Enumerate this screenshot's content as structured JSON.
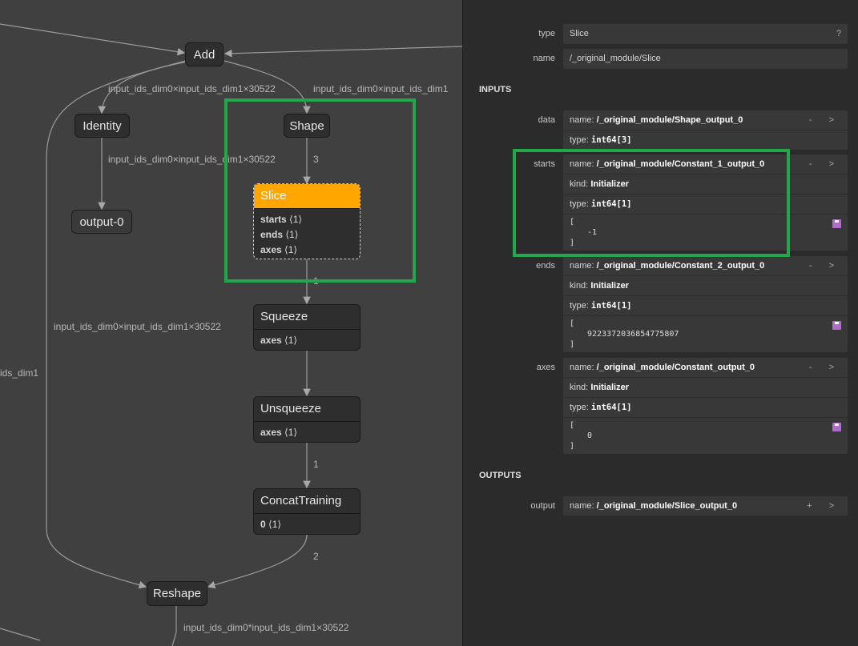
{
  "graph": {
    "nodes": {
      "add": "Add",
      "identity": "Identity",
      "shape": "Shape",
      "output0": "output-0",
      "slice": "Slice",
      "squeeze": "Squeeze",
      "unsqueeze": "Unsqueeze",
      "concat": "ConcatTraining",
      "reshape": "Reshape"
    },
    "slice_attrs": [
      {
        "k": "starts",
        "v": "⟨1⟩"
      },
      {
        "k": "ends",
        "v": "⟨1⟩"
      },
      {
        "k": "axes",
        "v": "⟨1⟩"
      }
    ],
    "squeeze_attrs": [
      {
        "k": "axes",
        "v": "⟨1⟩"
      }
    ],
    "unsqueeze_attrs": [
      {
        "k": "axes",
        "v": "⟨1⟩"
      }
    ],
    "concat_attrs": [
      {
        "k": "0",
        "v": "⟨1⟩"
      }
    ],
    "edge_labels": {
      "add_left": "input_ids_dim0×input_ids_dim1×30522",
      "add_right": "input_ids_dim0×input_ids_dim1",
      "identity_out": "input_ids_dim0×input_ids_dim1×30522",
      "shape_out": "3",
      "slice_out": "1",
      "bypass": "input_ids_dim0×input_ids_dim1×30522",
      "left_edge": "ids_dim1",
      "unsqueeze_out": "1",
      "concat_out": "2",
      "reshape_out": "input_ids_dim0*input_ids_dim1×30522"
    }
  },
  "panel": {
    "type_label": "type",
    "type_value": "Slice",
    "type_help": "?",
    "name_label": "name",
    "name_value": "/_original_module/Slice",
    "inputs_heading": "INPUTS",
    "outputs_heading": "OUTPUTS",
    "inputs": {
      "data": {
        "label": "data",
        "name_key": "name:",
        "name": "/_original_module/Shape_output_0",
        "type_key": "type:",
        "type": "int64[3]",
        "ctrl": "- >"
      },
      "starts": {
        "label": "starts",
        "name_key": "name:",
        "name": "/_original_module/Constant_1_output_0",
        "kind_key": "kind:",
        "kind": "Initializer",
        "type_key": "type:",
        "type": "int64[1]",
        "open": "[",
        "value": "-1",
        "close": "]",
        "ctrl": "- >"
      },
      "ends": {
        "label": "ends",
        "name_key": "name:",
        "name": "/_original_module/Constant_2_output_0",
        "kind_key": "kind:",
        "kind": "Initializer",
        "type_key": "type:",
        "type": "int64[1]",
        "open": "[",
        "value": "9223372036854775807",
        "close": "]",
        "ctrl": "- >"
      },
      "axes": {
        "label": "axes",
        "name_key": "name:",
        "name": "/_original_module/Constant_output_0",
        "kind_key": "kind:",
        "kind": "Initializer",
        "type_key": "type:",
        "type": "int64[1]",
        "open": "[",
        "value": "0",
        "close": "]",
        "ctrl": "- >"
      }
    },
    "output": {
      "label": "output",
      "name_key": "name:",
      "name": "/_original_module/Slice_output_0",
      "ctrl": "+ >"
    }
  },
  "colors": {
    "selected": "#ffa600",
    "highlight": "#22a84a",
    "save_icon": "#b06cc8"
  }
}
